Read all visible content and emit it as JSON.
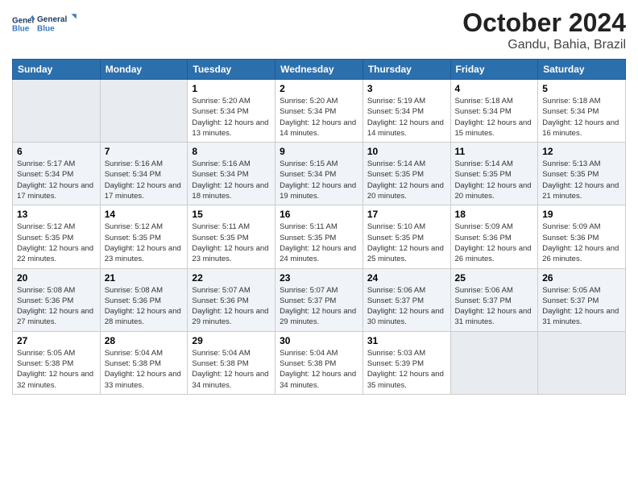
{
  "header": {
    "logo_line1": "General",
    "logo_line2": "Blue",
    "month_title": "October 2024",
    "location": "Gandu, Bahia, Brazil"
  },
  "weekdays": [
    "Sunday",
    "Monday",
    "Tuesday",
    "Wednesday",
    "Thursday",
    "Friday",
    "Saturday"
  ],
  "weeks": [
    [
      {
        "day": "",
        "info": ""
      },
      {
        "day": "",
        "info": ""
      },
      {
        "day": "1",
        "info": "Sunrise: 5:20 AM\nSunset: 5:34 PM\nDaylight: 12 hours and 13 minutes."
      },
      {
        "day": "2",
        "info": "Sunrise: 5:20 AM\nSunset: 5:34 PM\nDaylight: 12 hours and 14 minutes."
      },
      {
        "day": "3",
        "info": "Sunrise: 5:19 AM\nSunset: 5:34 PM\nDaylight: 12 hours and 14 minutes."
      },
      {
        "day": "4",
        "info": "Sunrise: 5:18 AM\nSunset: 5:34 PM\nDaylight: 12 hours and 15 minutes."
      },
      {
        "day": "5",
        "info": "Sunrise: 5:18 AM\nSunset: 5:34 PM\nDaylight: 12 hours and 16 minutes."
      }
    ],
    [
      {
        "day": "6",
        "info": "Sunrise: 5:17 AM\nSunset: 5:34 PM\nDaylight: 12 hours and 17 minutes."
      },
      {
        "day": "7",
        "info": "Sunrise: 5:16 AM\nSunset: 5:34 PM\nDaylight: 12 hours and 17 minutes."
      },
      {
        "day": "8",
        "info": "Sunrise: 5:16 AM\nSunset: 5:34 PM\nDaylight: 12 hours and 18 minutes."
      },
      {
        "day": "9",
        "info": "Sunrise: 5:15 AM\nSunset: 5:34 PM\nDaylight: 12 hours and 19 minutes."
      },
      {
        "day": "10",
        "info": "Sunrise: 5:14 AM\nSunset: 5:35 PM\nDaylight: 12 hours and 20 minutes."
      },
      {
        "day": "11",
        "info": "Sunrise: 5:14 AM\nSunset: 5:35 PM\nDaylight: 12 hours and 20 minutes."
      },
      {
        "day": "12",
        "info": "Sunrise: 5:13 AM\nSunset: 5:35 PM\nDaylight: 12 hours and 21 minutes."
      }
    ],
    [
      {
        "day": "13",
        "info": "Sunrise: 5:12 AM\nSunset: 5:35 PM\nDaylight: 12 hours and 22 minutes."
      },
      {
        "day": "14",
        "info": "Sunrise: 5:12 AM\nSunset: 5:35 PM\nDaylight: 12 hours and 23 minutes."
      },
      {
        "day": "15",
        "info": "Sunrise: 5:11 AM\nSunset: 5:35 PM\nDaylight: 12 hours and 23 minutes."
      },
      {
        "day": "16",
        "info": "Sunrise: 5:11 AM\nSunset: 5:35 PM\nDaylight: 12 hours and 24 minutes."
      },
      {
        "day": "17",
        "info": "Sunrise: 5:10 AM\nSunset: 5:35 PM\nDaylight: 12 hours and 25 minutes."
      },
      {
        "day": "18",
        "info": "Sunrise: 5:09 AM\nSunset: 5:36 PM\nDaylight: 12 hours and 26 minutes."
      },
      {
        "day": "19",
        "info": "Sunrise: 5:09 AM\nSunset: 5:36 PM\nDaylight: 12 hours and 26 minutes."
      }
    ],
    [
      {
        "day": "20",
        "info": "Sunrise: 5:08 AM\nSunset: 5:36 PM\nDaylight: 12 hours and 27 minutes."
      },
      {
        "day": "21",
        "info": "Sunrise: 5:08 AM\nSunset: 5:36 PM\nDaylight: 12 hours and 28 minutes."
      },
      {
        "day": "22",
        "info": "Sunrise: 5:07 AM\nSunset: 5:36 PM\nDaylight: 12 hours and 29 minutes."
      },
      {
        "day": "23",
        "info": "Sunrise: 5:07 AM\nSunset: 5:37 PM\nDaylight: 12 hours and 29 minutes."
      },
      {
        "day": "24",
        "info": "Sunrise: 5:06 AM\nSunset: 5:37 PM\nDaylight: 12 hours and 30 minutes."
      },
      {
        "day": "25",
        "info": "Sunrise: 5:06 AM\nSunset: 5:37 PM\nDaylight: 12 hours and 31 minutes."
      },
      {
        "day": "26",
        "info": "Sunrise: 5:05 AM\nSunset: 5:37 PM\nDaylight: 12 hours and 31 minutes."
      }
    ],
    [
      {
        "day": "27",
        "info": "Sunrise: 5:05 AM\nSunset: 5:38 PM\nDaylight: 12 hours and 32 minutes."
      },
      {
        "day": "28",
        "info": "Sunrise: 5:04 AM\nSunset: 5:38 PM\nDaylight: 12 hours and 33 minutes."
      },
      {
        "day": "29",
        "info": "Sunrise: 5:04 AM\nSunset: 5:38 PM\nDaylight: 12 hours and 34 minutes."
      },
      {
        "day": "30",
        "info": "Sunrise: 5:04 AM\nSunset: 5:38 PM\nDaylight: 12 hours and 34 minutes."
      },
      {
        "day": "31",
        "info": "Sunrise: 5:03 AM\nSunset: 5:39 PM\nDaylight: 12 hours and 35 minutes."
      },
      {
        "day": "",
        "info": ""
      },
      {
        "day": "",
        "info": ""
      }
    ]
  ]
}
